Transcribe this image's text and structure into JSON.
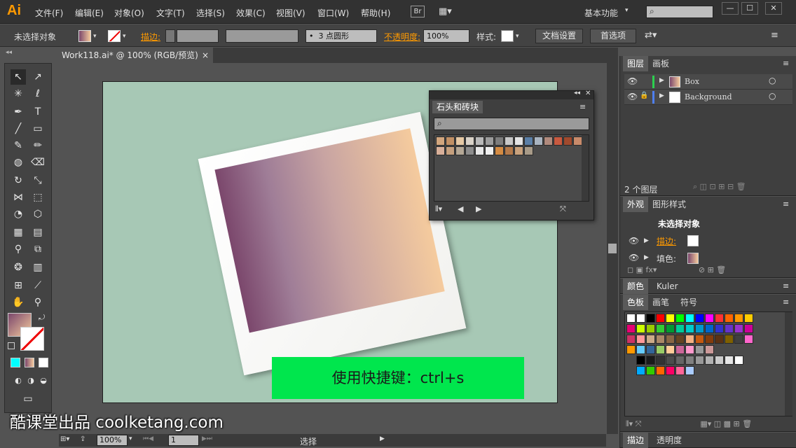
{
  "app": {
    "logo": "Ai",
    "workspace": "基本功能",
    "search_placeholder": ""
  },
  "menu": [
    "文件(F)",
    "编辑(E)",
    "对象(O)",
    "文字(T)",
    "选择(S)",
    "效果(C)",
    "视图(V)",
    "窗口(W)",
    "帮助(H)"
  ],
  "menu_extra": {
    "bridge": "Br"
  },
  "window_buttons": {
    "minimize": "—",
    "maximize": "☐",
    "close": "✕"
  },
  "control": {
    "no_selection": "未选择对象",
    "stroke_label": "描边:",
    "brush_value": "3 点圆形",
    "opacity_label": "不透明度:",
    "opacity_value": "100%",
    "style_label": "样式:",
    "doc_setup_button": "文档设置",
    "prefs_button": "首选项"
  },
  "document": {
    "tab_title": "Work118.ai* @ 100% (RGB/预览)",
    "close": "×"
  },
  "canvas": {
    "banner_text": "使用快捷键：ctrl+s",
    "watermark": "酷课堂出品 coolketang.com"
  },
  "library_panel": {
    "title": "石头和砖块",
    "search_placeholder": "",
    "swatch_colors": [
      "#d2a67e",
      "#c19065",
      "#e6c9a5",
      "#d9d2c8",
      "#b9b9b9",
      "#9c9c9c",
      "#7d7d7d",
      "#c8c8c8",
      "#e5e5e5",
      "#5b7fa6",
      "#a9b4c0",
      "#b08a7d",
      "#c85a40",
      "#a04a2e",
      "#c88a6a",
      "#d9b09a",
      "#c6a07e",
      "#b5a896",
      "#8d8d8d",
      "#e8e8e8",
      "#f0f0f0",
      "#d48b43",
      "#b47a4b",
      "#c9a27d",
      "#a89b88"
    ]
  },
  "layers_panel": {
    "tabs": [
      "图层",
      "画板"
    ],
    "layers": [
      {
        "name": "Box",
        "color": "#2cd04f"
      },
      {
        "name": "Background",
        "color": "#4e7ff0"
      }
    ],
    "count_label": "2 个图层"
  },
  "appearance_panel": {
    "tabs": [
      "外观",
      "图形样式"
    ],
    "title": "未选择对象",
    "rows": [
      "描边:",
      "填色:"
    ]
  },
  "color_panel": {
    "tabs": [
      "颜色",
      "Kuler"
    ]
  },
  "swatches_panel": {
    "tabs": [
      "色板",
      "画笔",
      "符号"
    ],
    "row1": [
      "#ffffff",
      "#ffffff",
      "#000000",
      "#ff0000",
      "#ffff00",
      "#00ff00",
      "#00ffff",
      "#0000ff",
      "#ff00ff",
      "#ff3333",
      "#ff6600",
      "#ff9900",
      "#ffcc00"
    ],
    "row2": [
      "#e60073",
      "#ccff00",
      "#99cc00",
      "#33cc33",
      "#009933",
      "#00cc99",
      "#00cccc",
      "#0099cc",
      "#0066cc",
      "#3333cc",
      "#6633cc",
      "#9933cc",
      "#cc0099"
    ],
    "row3": [
      "#cc3366",
      "#ff9999",
      "#ccaa88",
      "#aa8866",
      "#886644",
      "#664422",
      "#f4b183",
      "#c55a11",
      "#843c0c",
      "#5a3214",
      "#7f6000",
      "#404040",
      "#ff66cc"
    ],
    "row4": [
      "#ff9900",
      "#66ccff",
      "#336699",
      "#99cc66",
      "#ffcc99",
      "#cc6699",
      "#ff99cc",
      "#999999",
      "#cc9999"
    ],
    "row5": [
      "#000000",
      "#1a1a1a",
      "#333333",
      "#4d4d4d",
      "#666666",
      "#808080",
      "#999999",
      "#b3b3b3",
      "#cccccc",
      "#e6e6e6",
      "#ffffff"
    ],
    "row6": [
      "#00aaff",
      "#33cc00",
      "#ff6600",
      "#ff0066",
      "#ff6699",
      "#aaccff"
    ]
  },
  "bottom_dock": {
    "tabs": [
      "描边",
      "透明度"
    ]
  },
  "status": {
    "zoom": "100%",
    "page": "1",
    "tool": "选择"
  },
  "colors": {
    "accent_orange": "#ff9a00",
    "banner_green": "#00e64d",
    "artboard_bg": "#a7c8b5"
  }
}
